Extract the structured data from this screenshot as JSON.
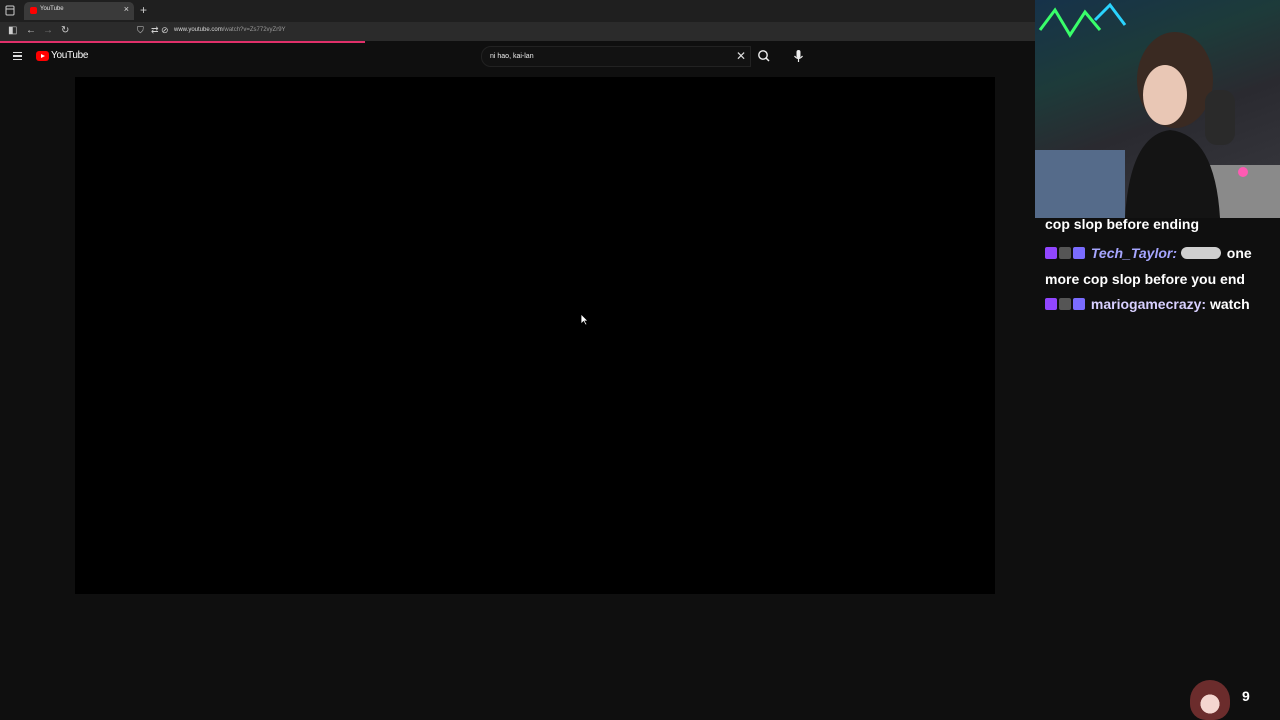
{
  "browser": {
    "tab_title": "YouTube",
    "url_domain": "www.youtube.com",
    "url_path": "/watch?v=Zs772vyZr9Y"
  },
  "youtube": {
    "wordmark": "YouTube",
    "search_value": "ni hao, kai-lan",
    "accent_color": "#ff0000"
  },
  "chat": {
    "messages": [
      {
        "text": "cop slop before ending"
      },
      {
        "user": "Tech_Taylor:",
        "text": "one"
      },
      {
        "text": "more cop slop before you end"
      },
      {
        "user": "mariogamecrazy:",
        "text": "watch"
      }
    ]
  },
  "overlay": {
    "count": "9"
  }
}
